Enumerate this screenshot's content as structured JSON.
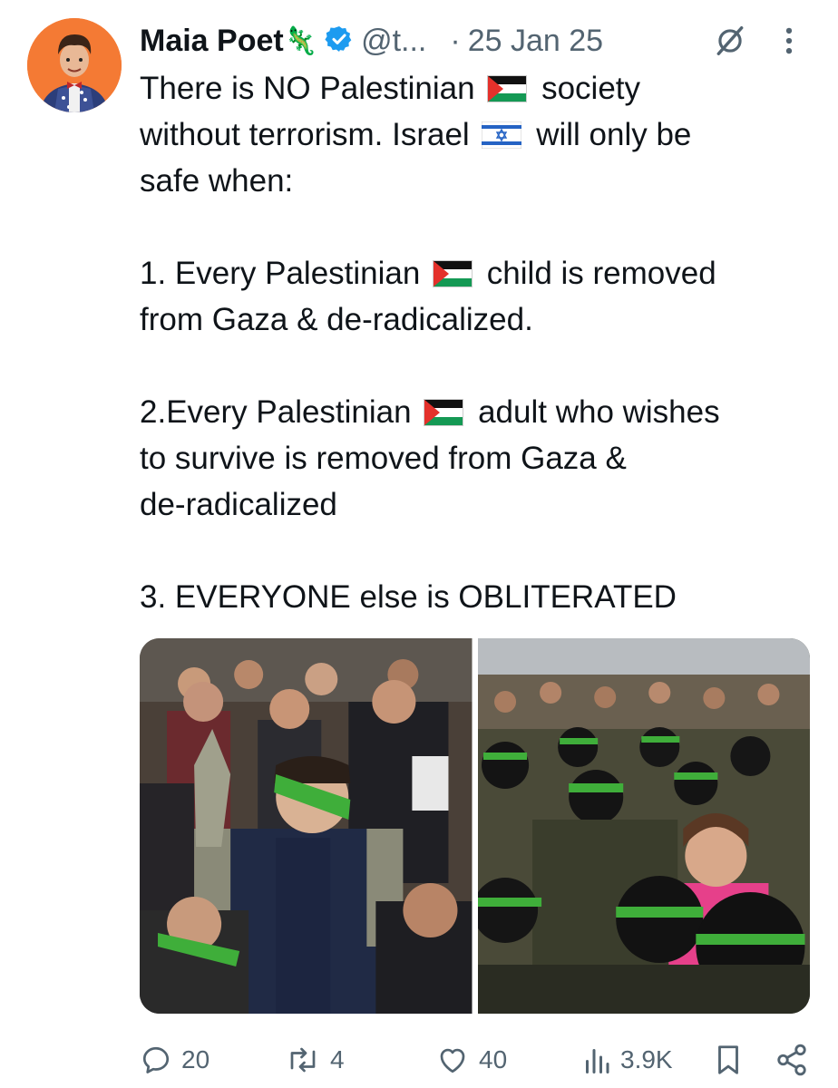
{
  "author": {
    "name": "Maia Poet",
    "name_emoji": "🦎",
    "handle": "@t...",
    "date": "25 Jan 25"
  },
  "tweet": {
    "line1_a": "There is NO Palestinian",
    "line1_b": "society",
    "line2_a": "without terrorism. Israel",
    "line2_b": "will only be",
    "line3": "safe when:",
    "item1_a": "1. Every Palestinian",
    "item1_b": "child is removed",
    "item1_c": "from Gaza & de-radicalized.",
    "item2_a": "2.Every Palestinian",
    "item2_b": "adult who wishes",
    "item2_c": "to survive is removed from Gaza &",
    "item2_d": "de-radicalized",
    "item3": "3. EVERYONE else is OBLITERATED"
  },
  "actions": {
    "replies": "20",
    "reposts": "4",
    "likes": "40",
    "views": "3.9K"
  }
}
